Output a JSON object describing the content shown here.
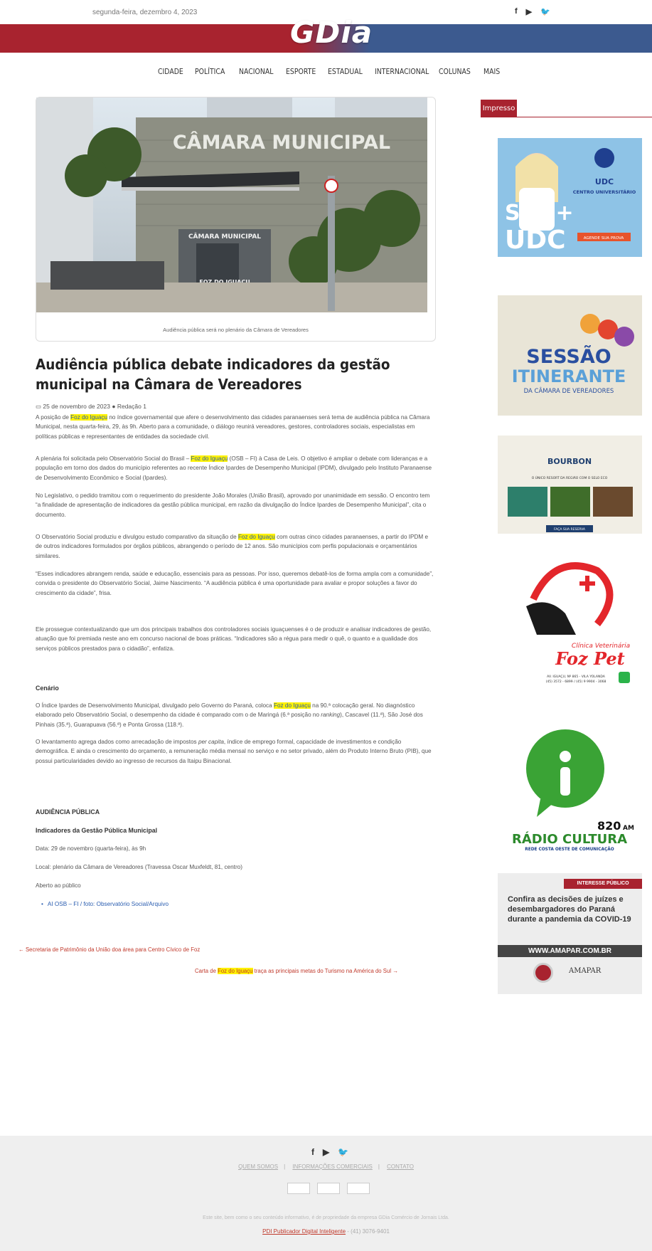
{
  "topbar": {
    "date": "segunda-feira, dezembro 4, 2023",
    "social": [
      "facebook-icon",
      "youtube-icon",
      "twitter-icon"
    ]
  },
  "logo": {
    "text": "GDia"
  },
  "nav": [
    "CIDADE",
    "POLÍTICA",
    "NACIONAL",
    "ESPORTE",
    "ESTADUAL",
    "INTERNACIONAL",
    "COLUNAS",
    "MAIS"
  ],
  "article": {
    "photo_sign_top": "CÂMARA MUNICIPAL",
    "photo_sign_small": "CÂMARA MUNICIPAL",
    "photo_sign_bottom": "FOZ DO IGUAÇU",
    "caption": "Audiência pública será no plenário da Câmara de Vereadores",
    "title": "Audiência pública debate indicadores da gestão municipal na Câmara de Vereadores",
    "date": "25 de novembro de 2023",
    "author": "Redação 1",
    "hl": "Foz do Iguaçu",
    "p1a": "A posição de ",
    "p1b": " no índice governamental que afere o desenvolvimento das cidades paranaenses será tema de audiência pública na Câmara Municipal, nesta quarta-feira, 29, às 9h. Aberto para a comunidade, o diálogo reunirá vereadores, gestores, controladores sociais, especialistas em políticas públicas e representantes de entidades da sociedade civil.",
    "p2a": "A plenária foi solicitada pelo Observatório Social do Brasil – ",
    "p2b": " (OSB – FI) à Casa de Leis. O objetivo é ampliar o debate com lideranças e a população em torno dos dados do município referentes ao recente Índice Ipardes de Desempenho Municipal (IPDM), divulgado pelo Instituto Paranaense de Desenvolvimento Econômico e Social (Ipardes).",
    "p3": "No Legislativo, o pedido tramitou com o requerimento do presidente João Morales (União Brasil), aprovado por unanimidade em sessão. O encontro tem “a finalidade de apresentação de indicadores da gestão pública municipal, em razão da divulgação do Índice Ipardes de Desempenho Municipal”, cita o documento.",
    "p4a": "O Observatório Social produziu e divulgou estudo comparativo da situação de ",
    "p4b": " com outras cinco cidades paranaenses, a partir do IPDM e de outros indicadores formulados por órgãos públicos, abrangendo o período de 12 anos. São municípios com perfis populacionais e orçamentários similares.",
    "p5": "“Esses indicadores abrangem renda, saúde e educação, essenciais para as pessoas. Por isso, queremos debatê-los de forma ampla com a comunidade”, convida o presidente do Observatório Social, Jaime Nascimento. “A audiência pública é uma oportunidade para avaliar e propor soluções a favor do crescimento da cidade”, frisa.",
    "p6": "Ele prossegue contextualizando que um dos principais trabalhos dos controladores sociais iguaçuenses é o de produzir e analisar indicadores de gestão, atuação que foi premiada neste ano em concurso nacional de boas práticas. “Indicadores são a régua para medir o quê, o quanto e a qualidade dos serviços públicos prestados para o cidadão”, enfatiza.",
    "h_cenario": "Cenário",
    "p7a": "O Índice Ipardes de Desenvolvimento Municipal, divulgado pelo Governo do Paraná, coloca ",
    "p7b": " na 90.ª colocação geral. No diagnóstico elaborado pelo Observatório Social, o desempenho da cidade é comparado com o de Maringá (6.ª posição no ",
    "p7c": "ranking",
    "p7d": "), Cascavel (11.ª), São José dos Pinhais (35.ª), Guarapuava (56.ª) e Ponta Grossa (118.ª).",
    "p8a": "O levantamento agrega dados como arrecadação de impostos ",
    "p8b": "per capita",
    "p8c": ", índice de emprego formal, capacidade de investimentos e condição demográfica. E ainda o crescimento do orçamento, a remuneração média mensal no serviço e no setor privado, além do Produto Interno Bruto (PIB), que possui particularidades devido ao ingresso de recursos da Itaipu Binacional.",
    "h_audiencia": "AUDIÊNCIA PÚBLICA",
    "h_indicadores": "Indicadores da Gestão Pública Municipal",
    "data_line": "Data: 29 de novembro (quarta-feira), às 9h",
    "local_line": "Local: plenário da Câmara de Vereadores (Travessa Oscar Muxfeldt, 81, centro)",
    "aberto_line": "Aberto ao público",
    "bullet": "AI OSB – FI /  foto: Observatório Social/Arquivo",
    "prev_link": "← Secretaria de Patrimônio da União doa área para Centro Cívico de Foz",
    "next_a": "Carta de ",
    "next_b": " traça as principais metas do Turismo na América do Sul →"
  },
  "sidebar": {
    "header": "Impresso",
    "ad1": {
      "sou": "SOU+",
      "udc": "UDC",
      "brand": "UDC",
      "sub": "CENTRO UNIVERSITÁRIO",
      "cta": "AGENDE SUA PROVA"
    },
    "ad2": {
      "l1": "SESSÃO",
      "l2": "ITINERANTE",
      "l3": "DA CÂMARA DE VEREADORES"
    },
    "ad3": {
      "brand": "BOURBON",
      "sub": "O ÚNICO RESORT DA REGIÃO COM O SELO ECO",
      "cta": "FAÇA SUA RESERVA"
    },
    "ad4": {
      "l1": "Clínica Veterinária",
      "l2": "Foz Pet",
      "addr": "AV. IGUAÇU, Nº 865 - VILA YOLANDA",
      "tel": "(45) 3572 - 6899 / (45) 9 9904 - 3068"
    },
    "ad5": {
      "freq": "820",
      "am": "AM",
      "name": "RÁDIO CULTURA",
      "sub": "REDE COSTA OESTE DE COMUNICAÇÃO"
    },
    "ad6": {
      "tag": "INTERESSE PÚBLICO",
      "text": "Confira as decisões de juízes e desembargadores do Paraná durante a pandemia da COVID-19",
      "url": "WWW.AMAPAR.COM.BR",
      "brand": "AMAPAR"
    }
  },
  "footer": {
    "links": [
      "QUEM SOMOS",
      "INFORMAÇÕES COMERCIAIS",
      "CONTATO"
    ],
    "copy": "Este site, bem como o seu conteúdo informativo, é de propriedade da empresa GDia Comércio de Jornais Ltda.",
    "pdi": "PDI Publicador Digital Inteligente",
    "tel": "- (41) 3076-9401"
  }
}
